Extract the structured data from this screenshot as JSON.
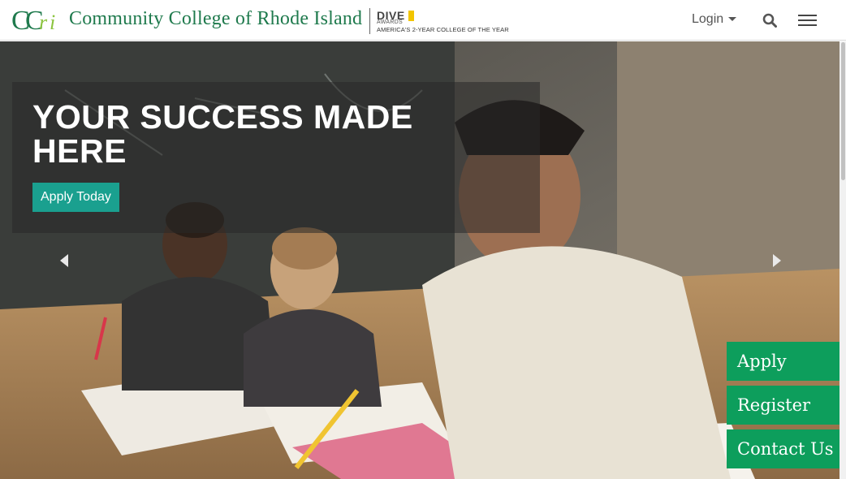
{
  "header": {
    "college_name": "Community College of Rhode Island",
    "logo_icon": "ccri-logo-icon",
    "dive_badge": {
      "title": "DIVE",
      "subtitle": "AWARDS",
      "tagline": "AMERICA'S 2-YEAR COLLEGE OF THE YEAR"
    },
    "login_label": "Login",
    "search_icon": "search-icon",
    "menu_icon": "hamburger-menu-icon"
  },
  "hero": {
    "headline": "YOUR SUCCESS MADE HERE",
    "cta_label": "Apply Today",
    "prev_label": "Previous",
    "next_label": "Next"
  },
  "quick_links": [
    {
      "label": "Apply"
    },
    {
      "label": "Register"
    },
    {
      "label": "Contact Us"
    }
  ],
  "colors": {
    "brand_green": "#1f7a4d",
    "cta_teal": "#1aa08f",
    "quick_link_green": "#0d9e5c"
  }
}
